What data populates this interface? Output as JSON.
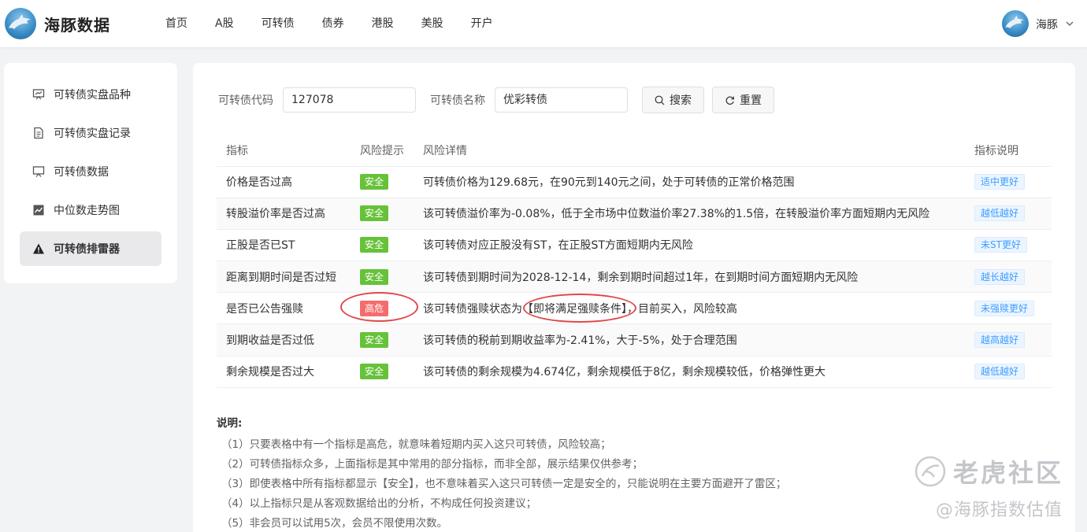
{
  "header": {
    "brand": "海豚数据",
    "nav": [
      "首页",
      "A股",
      "可转债",
      "债券",
      "港股",
      "美股",
      "开户"
    ],
    "username": "海豚"
  },
  "sidebar": {
    "items": [
      {
        "label": "可转债实盘品种",
        "icon": "presentation-chart-icon",
        "active": false
      },
      {
        "label": "可转债实盘记录",
        "icon": "document-icon",
        "active": false
      },
      {
        "label": "可转债数据",
        "icon": "screen-icon",
        "active": false
      },
      {
        "label": "中位数走势图",
        "icon": "line-chart-icon",
        "active": false
      },
      {
        "label": "可转债排雷器",
        "icon": "warning-icon",
        "active": true
      }
    ]
  },
  "search": {
    "code_label": "可转债代码",
    "code_value": "127078",
    "name_label": "可转债名称",
    "name_value": "优彩转债",
    "search_button": "搜索",
    "reset_button": "重置"
  },
  "table": {
    "headers": [
      "指标",
      "风险提示",
      "风险详情",
      "指标说明"
    ],
    "rows": [
      {
        "indicator": "价格是否过高",
        "risk": "安全",
        "level": "safe",
        "detail": "可转债价格为129.68元，在90元到140元之间，处于可转债的正常价格范围",
        "note": "适中更好"
      },
      {
        "indicator": "转股溢价率是否过高",
        "risk": "安全",
        "level": "safe",
        "detail": "该可转债溢价率为-0.08%，低于全市场中位数溢价率27.38%的1.5倍，在转股溢价率方面短期内无风险",
        "note": "越低越好"
      },
      {
        "indicator": "正股是否已ST",
        "risk": "安全",
        "level": "safe",
        "detail": "该可转债对应正股没有ST，在正股ST方面短期内无风险",
        "note": "未ST更好"
      },
      {
        "indicator": "距离到期时间是否过短",
        "risk": "安全",
        "level": "safe",
        "detail": "该可转债到期时间为2028-12-14，剩余到期时间超过1年，在到期时间方面短期内无风险",
        "note": "越长越好"
      },
      {
        "indicator": "是否已公告强赎",
        "risk": "高危",
        "level": "danger",
        "detail": "该可转债强赎状态为【即将满足强赎条件】，目前买入，风险较高",
        "note": "未强赎更好"
      },
      {
        "indicator": "到期收益是否过低",
        "risk": "安全",
        "level": "safe",
        "detail": "该可转债的税前到期收益率为-2.41%，大于-5%，处于合理范围",
        "note": "越高越好"
      },
      {
        "indicator": "剩余规模是否过大",
        "risk": "安全",
        "level": "safe",
        "detail": "该可转债的剩余规模为4.674亿，剩余规模低于8亿，剩余规模较低，价格弹性更大",
        "note": "越低越好"
      }
    ]
  },
  "notes": {
    "title": "说明:",
    "lines": [
      "（1）只要表格中有一个指标是高危，就意味着短期内买入这只可转债，风险较高；",
      "（2）可转债指标众多，上面指标是其中常用的部分指标，而非全部，展示结果仅供参考；",
      "（3）即使表格中所有指标都显示【安全】，也不意味着买入这只可转债一定是安全的，只能说明在主要方面避开了雷区；",
      "（4）以上指标只是从客观数据给出的分析，不构成任何投资建议；",
      "（5）非会员可以试用5次，会员不限使用次数。"
    ]
  },
  "watermark": {
    "line1": "老虎社区",
    "line2": "@海豚指数估值"
  },
  "colors": {
    "safe": "#67c23a",
    "danger": "#f56c6c",
    "note_text": "#409eff",
    "annotation_circle": "#e04848"
  }
}
